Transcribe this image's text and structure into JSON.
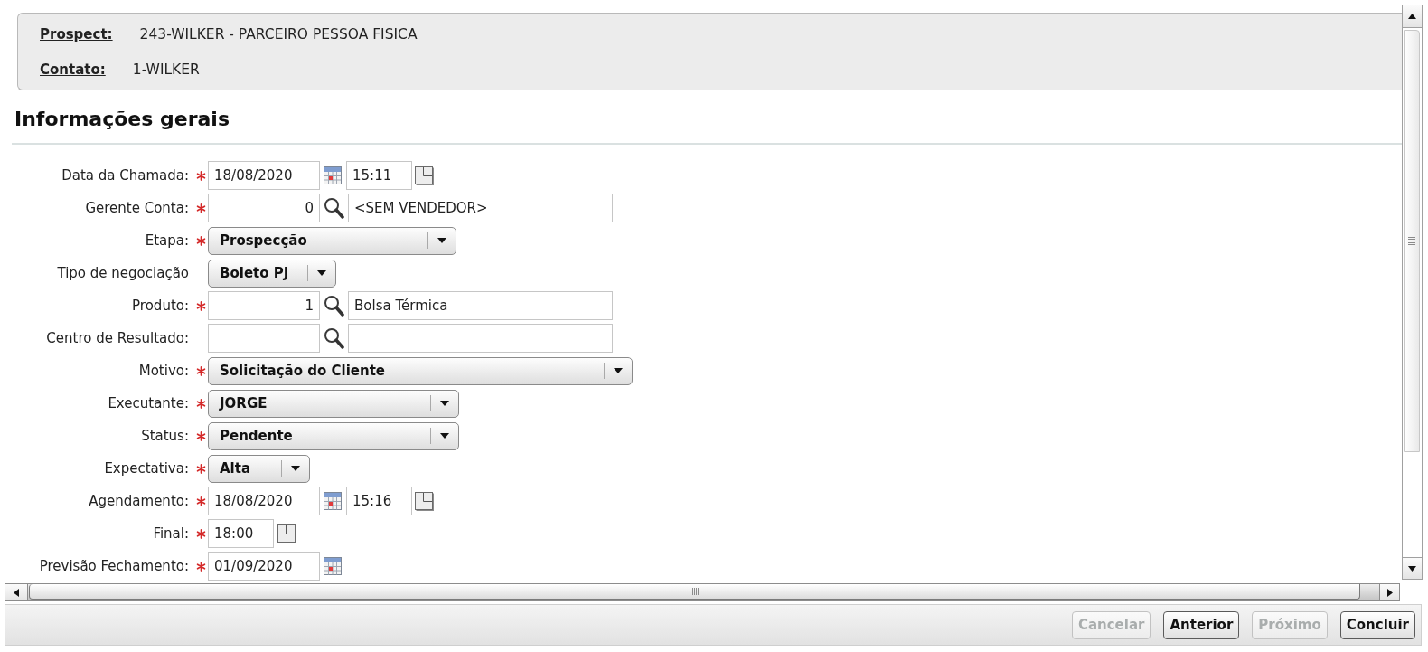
{
  "header": {
    "rows": [
      {
        "label": "Prospect:",
        "value": "243-WILKER - PARCEIRO PESSOA FISICA"
      },
      {
        "label": "Contato:",
        "value": "1-WILKER"
      }
    ]
  },
  "section": {
    "title": "Informações gerais"
  },
  "form": {
    "rows": [
      {
        "kind": "datetime",
        "label": "Data da Chamada:",
        "required": true,
        "date": "18/08/2020",
        "time": "15:11"
      },
      {
        "kind": "lookup",
        "label": "Gerente Conta:",
        "required": true,
        "code": "0",
        "description": "<SEM VENDEDOR>"
      },
      {
        "kind": "select",
        "label": "Etapa:",
        "required": true,
        "value": "Prospecção"
      },
      {
        "kind": "select",
        "label": "Tipo de negociação",
        "required": false,
        "value": "Boleto PJ"
      },
      {
        "kind": "lookup",
        "label": "Produto:",
        "required": true,
        "code": "1",
        "description": "Bolsa Térmica"
      },
      {
        "kind": "lookup",
        "label": "Centro de Resultado:",
        "required": false
      },
      {
        "kind": "select",
        "label": "Motivo:",
        "required": true,
        "value": "Solicitação do Cliente"
      },
      {
        "kind": "select",
        "label": "Executante:",
        "required": true,
        "value": "JORGE"
      },
      {
        "kind": "select",
        "label": "Status:",
        "required": true,
        "value": "Pendente"
      },
      {
        "kind": "select",
        "label": "Expectativa:",
        "required": true,
        "value": "Alta"
      },
      {
        "kind": "datetime",
        "label": "Agendamento:",
        "required": true,
        "date": "18/08/2020",
        "time": "15:16"
      },
      {
        "kind": "time",
        "label": "Final:",
        "required": true,
        "time": "18:00"
      },
      {
        "kind": "date",
        "label": "Previsão Fechamento:",
        "required": true,
        "date": "01/09/2020"
      }
    ]
  },
  "buttons": [
    {
      "label": "Cancelar",
      "disabled": true
    },
    {
      "label": "Anterior",
      "disabled": false
    },
    {
      "label": "Próximo",
      "disabled": true
    },
    {
      "label": "Concluir",
      "disabled": false
    }
  ]
}
